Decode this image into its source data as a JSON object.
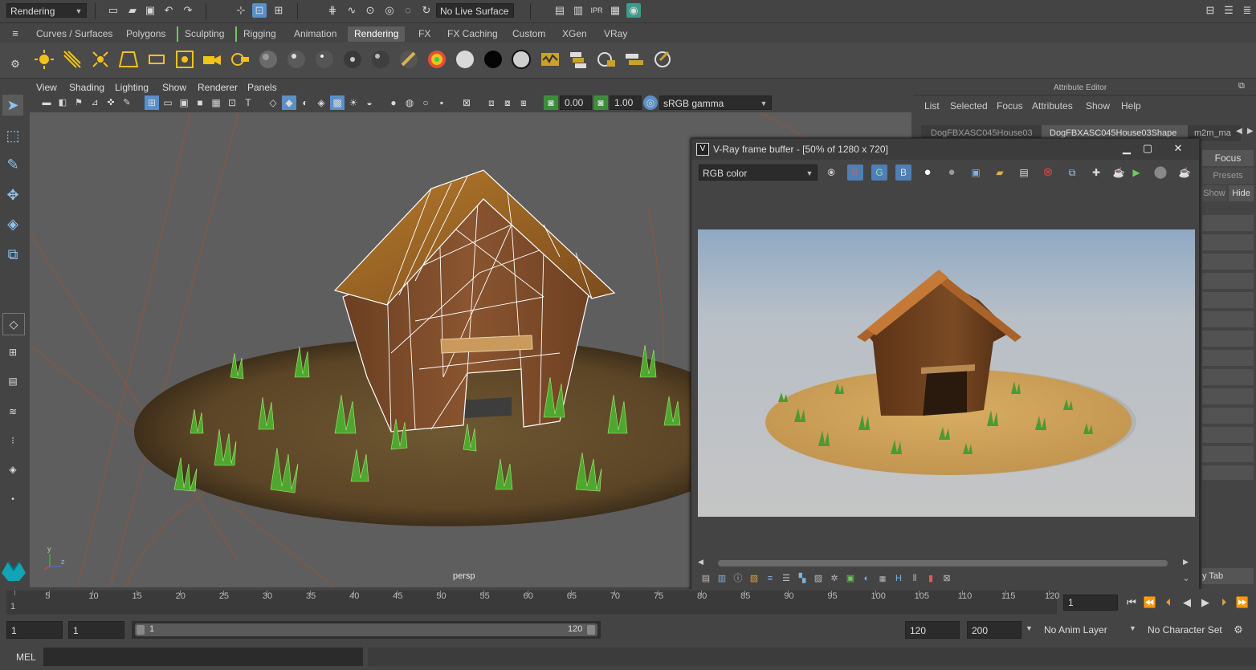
{
  "status_line": {
    "menu_set": "Rendering",
    "live_surface": "No Live Surface"
  },
  "shelf_tabs": [
    "Curves / Surfaces",
    "Polygons",
    "Sculpting",
    "Rigging",
    "Animation",
    "Rendering",
    "FX",
    "FX Caching",
    "Custom",
    "XGen",
    "VRay"
  ],
  "active_shelf_tab": "Rendering",
  "viewport": {
    "menu": [
      "View",
      "Shading",
      "Lighting",
      "Show",
      "Renderer",
      "Panels"
    ],
    "exposure": "0.00",
    "gamma": "1.00",
    "color_space": "sRGB gamma",
    "camera_label": "persp",
    "axis_y": "y",
    "axis_z": "z"
  },
  "attribute_editor": {
    "title": "Attribute Editor",
    "menu": [
      "List",
      "Selected",
      "Focus",
      "Attributes",
      "Show",
      "Help"
    ],
    "tabs": [
      "DogFBXASC045House03",
      "DogFBXASC045House03Shape",
      "m2m_ma"
    ],
    "focus_label": "Focus",
    "presets_label": "Presets",
    "show_label": "Show",
    "hide_label": "Hide",
    "copy_tab_label": "y Tab"
  },
  "vray_fb": {
    "title": "V-Ray frame buffer - [50% of 1280 x 720]",
    "channel": "RGB color",
    "r_label": "R",
    "g_label": "G",
    "b_label": "B"
  },
  "time_slider": {
    "ticks": [
      1,
      5,
      10,
      15,
      20,
      25,
      30,
      35,
      40,
      45,
      50,
      55,
      60,
      65,
      70,
      75,
      80,
      85,
      90,
      95,
      100,
      105,
      110,
      115,
      120
    ],
    "current_frame": "1"
  },
  "range_slider": {
    "start": "1",
    "playback_start": "1",
    "range_start_label": "1",
    "range_end_label": "120",
    "playback_end": "120",
    "end": "200",
    "anim_layer": "No Anim Layer",
    "character_set": "No Character Set"
  },
  "command_line": {
    "label": "MEL"
  },
  "colors": {
    "panel_bg": "#444444",
    "viewport_bg": "#5e5e5e",
    "accent_blue": "#5a8fc7",
    "active_tab": "#5d5d5d",
    "wireframe": "#ffffff",
    "sky": "#90a9c2"
  }
}
